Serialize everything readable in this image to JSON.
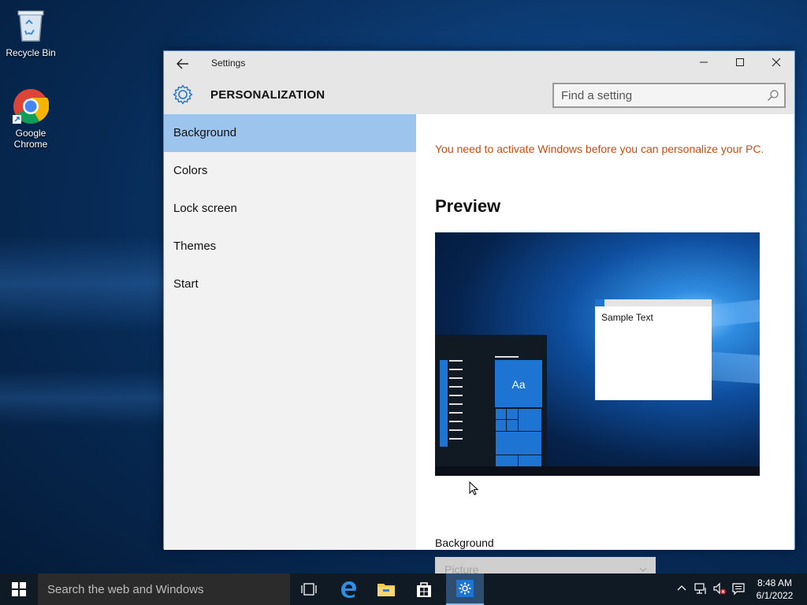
{
  "desktop": {
    "icons": [
      {
        "label": "Recycle Bin",
        "icon": "recycle-bin-icon"
      },
      {
        "label": "Google Chrome",
        "icon": "chrome-icon"
      }
    ]
  },
  "window": {
    "title": "Settings",
    "controls": {
      "minimize": "minimize-icon",
      "maximize": "maximize-icon",
      "close": "close-icon"
    }
  },
  "header": {
    "title": "PERSONALIZATION",
    "search_placeholder": "Find a setting"
  },
  "nav": {
    "items": [
      {
        "label": "Background",
        "selected": true
      },
      {
        "label": "Colors",
        "selected": false
      },
      {
        "label": "Lock screen",
        "selected": false
      },
      {
        "label": "Themes",
        "selected": false
      },
      {
        "label": "Start",
        "selected": false
      }
    ]
  },
  "content": {
    "activation_message": "You need to activate Windows before you can personalize your PC.",
    "preview_heading": "Preview",
    "preview": {
      "sample_text": "Sample Text",
      "tile_text": "Aa"
    },
    "background_label": "Background",
    "background_value": "Picture"
  },
  "taskbar": {
    "search_placeholder": "Search the web and Windows",
    "apps": [
      "task-view-icon",
      "edge-icon",
      "file-explorer-icon",
      "store-icon",
      "settings-icon"
    ],
    "time": "8:48 AM",
    "date": "6/1/2022"
  },
  "colors": {
    "selected_nav": "#9dc4ec",
    "warning_text": "#d34a0f",
    "accent": "#1d74d2"
  }
}
